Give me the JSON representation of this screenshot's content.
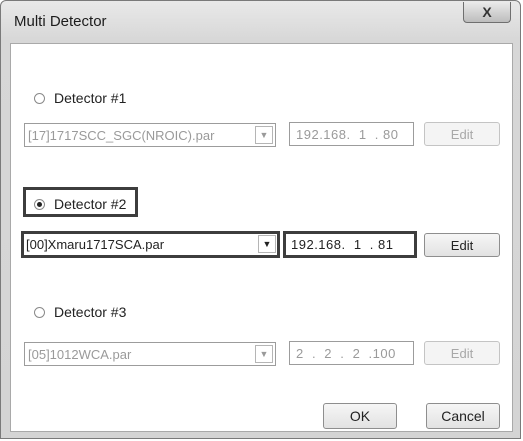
{
  "window": {
    "title": "Multi Detector",
    "close_label": "X"
  },
  "detectors": [
    {
      "label": "Detector #1",
      "checked": false,
      "file": "[17]1717SCC_SGC(NROIC).par",
      "ip": "192.168.  1  . 80",
      "edit_label": "Edit",
      "enabled": false
    },
    {
      "label": "Detector #2",
      "checked": true,
      "file": "[00]Xmaru1717SCA.par",
      "ip": "192.168.  1  . 81",
      "edit_label": "Edit",
      "enabled": true
    },
    {
      "label": "Detector #3",
      "checked": false,
      "file": "[05]1012WCA.par",
      "ip": "2  .  2  .  2  .100",
      "edit_label": "Edit",
      "enabled": false
    }
  ],
  "footer": {
    "ok_label": "OK",
    "cancel_label": "Cancel"
  },
  "icons": {
    "dropdown": "chevron-down-icon",
    "close": "close-icon"
  }
}
